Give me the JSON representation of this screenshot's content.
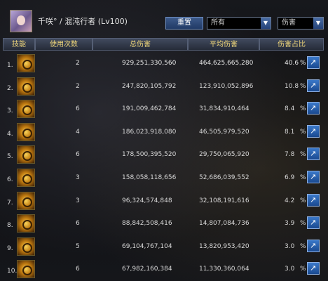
{
  "header": {
    "character": "千咲° / 混沌行者 (Lv100)",
    "reset_label": "重置",
    "target_select": "所有",
    "type_select": "伤害"
  },
  "columns": [
    "技能",
    "使用次数",
    "总伤害",
    "平均伤害",
    "伤害占比"
  ],
  "rows": [
    {
      "rank": "1.",
      "uses": "2",
      "total": "929,251,330,560",
      "avg": "464,625,665,280",
      "pct": "40.6"
    },
    {
      "rank": "2.",
      "uses": "2",
      "total": "247,820,105,792",
      "avg": "123,910,052,896",
      "pct": "10.8"
    },
    {
      "rank": "3.",
      "uses": "6",
      "total": "191,009,462,784",
      "avg": "31,834,910,464",
      "pct": "8.4"
    },
    {
      "rank": "4.",
      "uses": "4",
      "total": "186,023,918,080",
      "avg": "46,505,979,520",
      "pct": "8.1"
    },
    {
      "rank": "5.",
      "uses": "6",
      "total": "178,500,395,520",
      "avg": "29,750,065,920",
      "pct": "7.8"
    },
    {
      "rank": "6.",
      "uses": "3",
      "total": "158,058,118,656",
      "avg": "52,686,039,552",
      "pct": "6.9"
    },
    {
      "rank": "7.",
      "uses": "3",
      "total": "96,324,574,848",
      "avg": "32,108,191,616",
      "pct": "4.2"
    },
    {
      "rank": "8.",
      "uses": "6",
      "total": "88,842,508,416",
      "avg": "14,807,084,736",
      "pct": "3.9"
    },
    {
      "rank": "9.",
      "uses": "5",
      "total": "69,104,767,104",
      "avg": "13,820,953,420",
      "pct": "3.0"
    },
    {
      "rank": "10.",
      "uses": "6",
      "total": "67,982,160,384",
      "avg": "11,330,360,064",
      "pct": "3.0"
    }
  ],
  "percent_sign": "%",
  "share_icon": "share-icon"
}
